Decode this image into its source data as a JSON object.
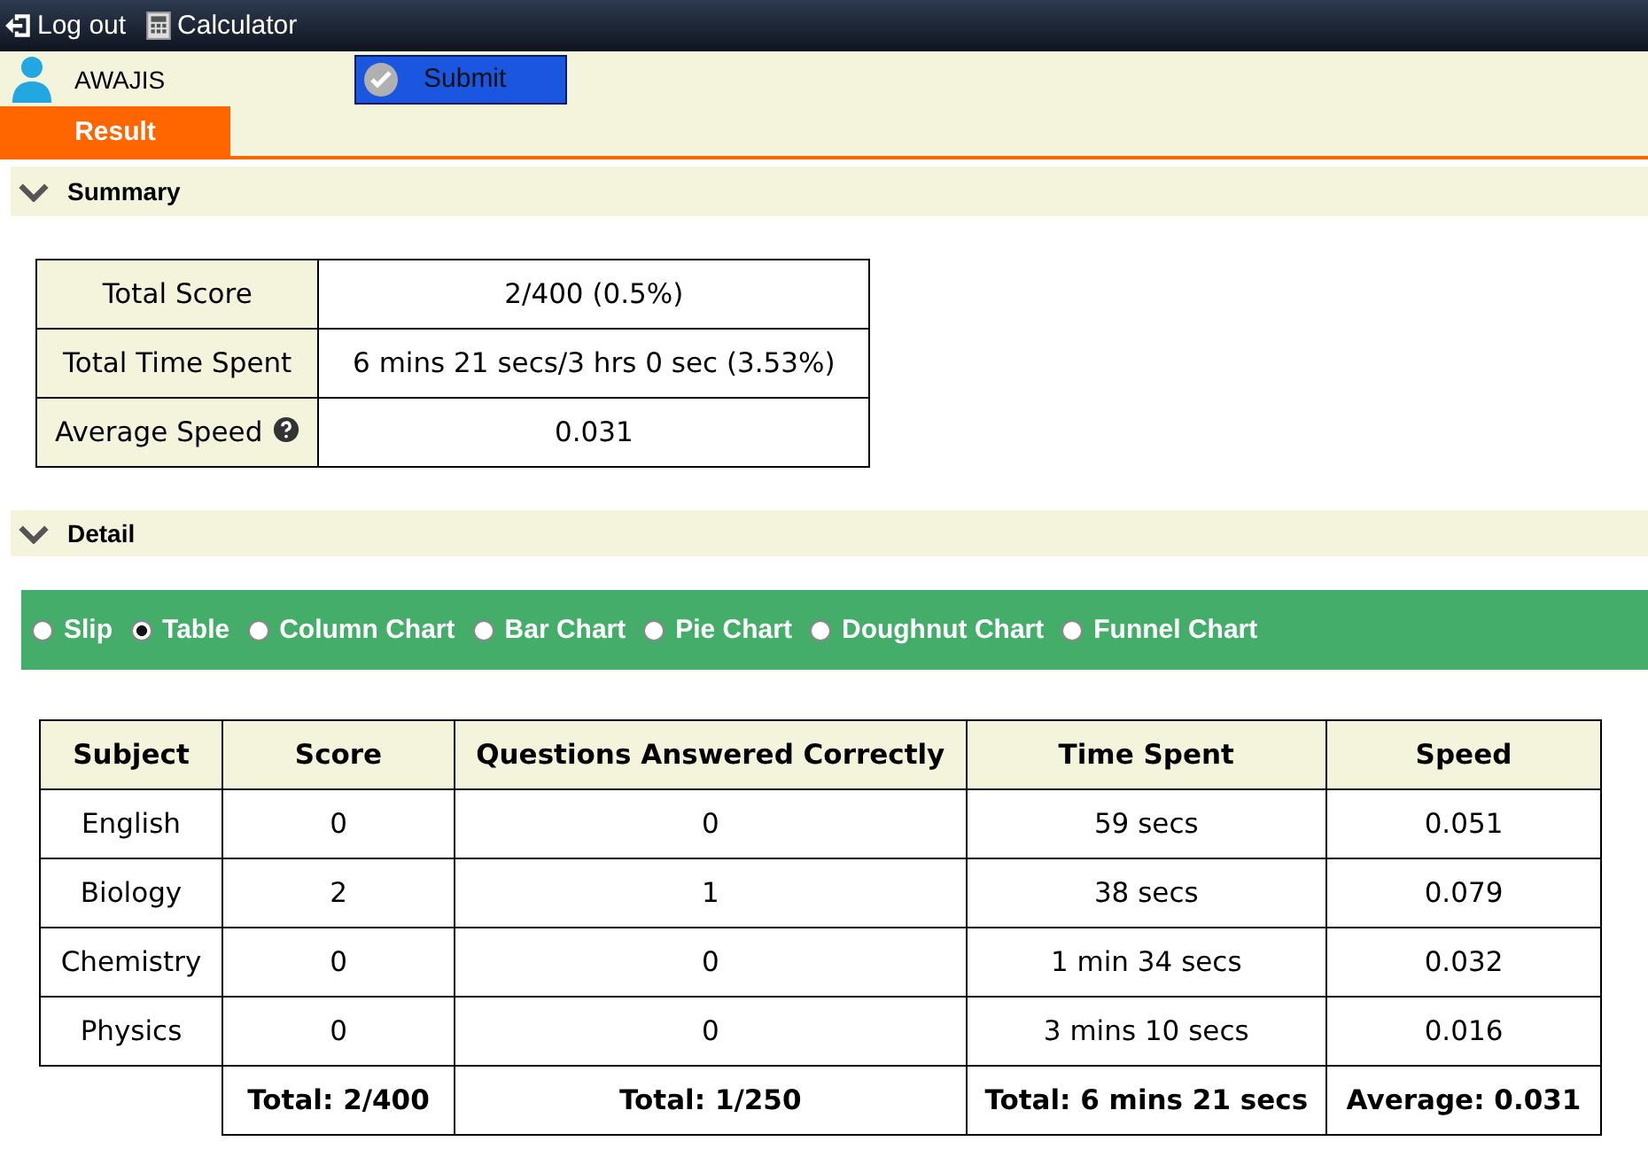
{
  "top_bar": {
    "items": [
      {
        "kind": "logout",
        "label": "Log out"
      },
      {
        "kind": "calculator",
        "label": "Calculator"
      }
    ]
  },
  "user": {
    "name": "AWAJIS"
  },
  "submit_button": {
    "label": "Submit"
  },
  "tabs": [
    {
      "label": "Result",
      "selected": true
    }
  ],
  "summary": {
    "title": "Summary",
    "expanded": true,
    "rows": [
      {
        "label": "Total Score",
        "value": "2/400 (0.5%)",
        "help": false
      },
      {
        "label": "Total Time Spent",
        "value": "6 mins 21 secs/3 hrs 0 sec (3.53%)",
        "help": false
      },
      {
        "label": "Average Speed",
        "value": "0.031",
        "help": true
      }
    ]
  },
  "detail": {
    "title": "Detail",
    "expanded": true,
    "views": [
      {
        "label": "Slip",
        "selected": false
      },
      {
        "label": "Table",
        "selected": true
      },
      {
        "label": "Column Chart",
        "selected": false
      },
      {
        "label": "Bar Chart",
        "selected": false
      },
      {
        "label": "Pie Chart",
        "selected": false
      },
      {
        "label": "Doughnut Chart",
        "selected": false
      },
      {
        "label": "Funnel Chart",
        "selected": false
      }
    ],
    "table": {
      "columns": [
        "Subject",
        "Score",
        "Questions Answered Correctly",
        "Time Spent",
        "Speed"
      ],
      "rows": [
        [
          "English",
          "0",
          "0",
          "59 secs",
          "0.051"
        ],
        [
          "Biology",
          "2",
          "1",
          "38 secs",
          "0.079"
        ],
        [
          "Chemistry",
          "0",
          "0",
          "1 min 34 secs",
          "0.032"
        ],
        [
          "Physics",
          "0",
          "0",
          "3 mins 10 secs",
          "0.016"
        ]
      ],
      "totals": [
        "Total: 2/400",
        "Total: 1/250",
        "Total: 6 mins 21 secs",
        "Average: 0.031"
      ]
    }
  }
}
